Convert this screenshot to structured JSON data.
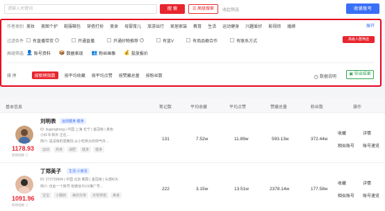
{
  "search": {
    "placeholder": "请输入关键词",
    "button": "搜 索",
    "advanced": "高级搜索",
    "favorites": "收起筛选"
  },
  "fav_account": "收录账号",
  "filters": {
    "category_label": "作者类别",
    "categories": [
      "美妆",
      "美图个护",
      "鞋服箱包",
      "穿搭打扮",
      "美食",
      "母婴育儿",
      "旅游出行",
      "家居家装",
      "教育",
      "生活",
      "运动健身",
      "兴趣爱好",
      "影视综",
      "婚嫁"
    ],
    "expand": "展开",
    "condition_label": "过滤条件",
    "conditions": [
      "有直播带货",
      "开通直播",
      "开通好物推荐",
      "有蓝V",
      "有商品橱合作",
      "有联系方式"
    ],
    "vip_badge": "高级人群筛选",
    "quick_label": "高级筛选",
    "quick": [
      {
        "icon": "👤",
        "label": "账号资料",
        "color": "#3a6ff7"
      },
      {
        "icon": "📦",
        "label": "数据表现",
        "color": "#e8252e"
      },
      {
        "icon": "👥",
        "label": "粉丝画像",
        "color": "#2da44e"
      },
      {
        "icon": "💰",
        "label": "投放报价",
        "color": "#f5a623"
      }
    ]
  },
  "sort": {
    "label": "排 序",
    "active": "按新榜指数",
    "items": [
      "按平均收藏",
      "按平均点赞",
      "按赞藏总量",
      "按粉丝数"
    ]
  },
  "data_desc": "数据说明",
  "export": "导出结果",
  "table": {
    "headers": [
      "基本信息",
      "笔记数",
      "平均收藏",
      "平均点赞",
      "赞藏总量",
      "粉丝数",
      "操作"
    ],
    "rows": [
      {
        "name": "刘明表",
        "category": "运动健身-健身",
        "score": "1178.93",
        "score_sub": "新榜指数 ⓘ",
        "meta": "ID: liugenghong | 中国 上海 长宁 | 金冠级 | 真色",
        "meta2": "小红书 新外 正在...",
        "desc": "简介: 是深夜的更教授,从小吃到大的帅气外...",
        "tags": [
          "运动",
          "热身",
          "减肥",
          "健身",
          "健身"
        ],
        "notes": "131",
        "avg_fav": "7.52w",
        "avg_like": "11.89w",
        "total": "593.13w",
        "fans": "372.44w",
        "op1": "收藏",
        "op2": "详情",
        "op3": "相似账号",
        "op4": "账号速览"
      },
      {
        "name": "丁郑美子",
        "category": "生活-小家活",
        "score": "1091.96",
        "score_sub": "新榜指数 ⓘ",
        "meta": "ID: 272729994 | 中国 北京 朝阳 | 金冠级 | 头部KOL",
        "meta2": "",
        "desc": "简介: 仅此一个账号 有微信与VX推广号...",
        "tags": [
          "宝宝",
          "小翻转",
          "美的日常",
          "日常穿搭",
          "美食"
        ],
        "notes": "222",
        "avg_fav": "3.15w",
        "avg_like": "13.51w",
        "total": "2378.14w",
        "fans": "177.58w",
        "op1": "收藏",
        "op2": "详情",
        "op3": "相似账号",
        "op4": "账号速览"
      }
    ]
  },
  "colors": {
    "accent": "#e8252e",
    "primary": "#3a6ff7",
    "export": "#2da44e"
  }
}
